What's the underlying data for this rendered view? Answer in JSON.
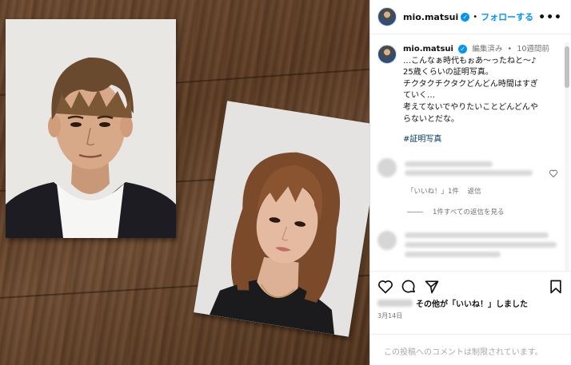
{
  "post": {
    "username": "mio.matsui",
    "follow_label": "フォローする",
    "header_separator": "•",
    "caption": {
      "edited_label": "編集済み",
      "separator": "•",
      "time_ago": "10週間前",
      "lines": [
        "…こんなぁ時代もぉあ〜ったねと〜♪",
        "25歳くらいの証明写真。",
        "チクタクチクタクどんどん時間はすぎ",
        "ていく…",
        "考えてないでやりたいことどんどんや",
        "らないとだな。"
      ],
      "hashtag": "#証明写真"
    },
    "comment": {
      "likes_label": "「いいね！」1件",
      "reply_label": "返信",
      "view_replies_label": "1件すべての返信を見る"
    },
    "likes_suffix": "その他が「いいね！」しました",
    "date": "3月14日",
    "comments_disabled": "この投稿へのコメントは制限されています。"
  },
  "icons": {
    "verified": "verified-badge-icon",
    "more": "more-options-icon",
    "like": "heart-icon",
    "comment": "comment-bubble-icon",
    "share": "paper-plane-icon",
    "save": "bookmark-icon"
  },
  "colors": {
    "link_blue": "#0095f6",
    "hashtag": "#00376b",
    "muted": "#737373",
    "wood": "#5a3b24"
  }
}
